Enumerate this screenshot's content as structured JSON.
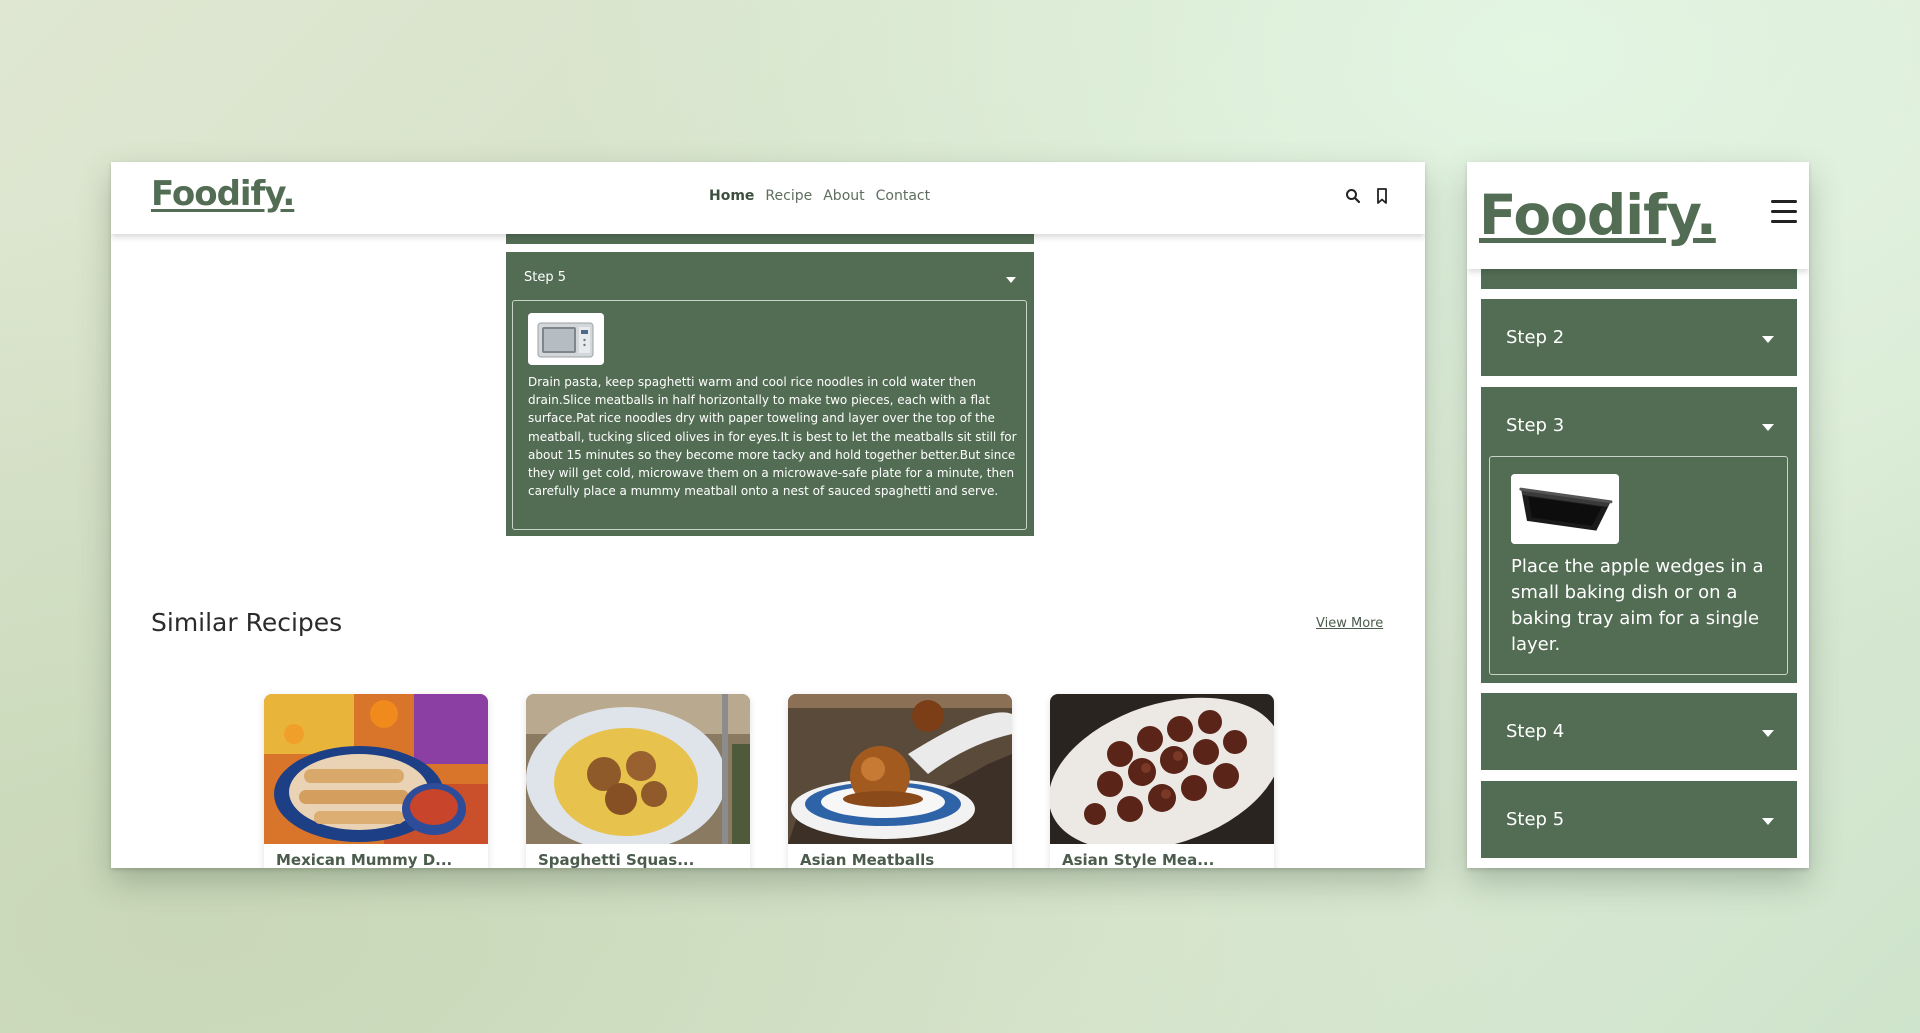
{
  "brand": {
    "logo": "Foodify."
  },
  "nav": {
    "items": [
      {
        "label": "Home"
      },
      {
        "label": "Recipe"
      },
      {
        "label": "About"
      },
      {
        "label": "Contact"
      }
    ]
  },
  "icons": {
    "search": "search-icon",
    "bookmark": "bookmark-icon",
    "menu": "hamburger-menu-icon",
    "dropdown": "caret-down-icon"
  },
  "desktop_step": {
    "label": "Step 5",
    "text": "Drain pasta, keep spaghetti warm and cool rice noodles in cold water then drain.Slice meatballs in half horizontally to make two pieces, each with a flat surface.Pat rice noodles dry with paper toweling and layer over the top of the meatball, tucking sliced olives in for eyes.It is best to let the meatballs sit still for about 15 minutes so they become more tacky and hold together better.But since they will get cold, microwave them on a microwave-safe plate for a minute, then carefully place a mummy meatball onto a nest of sauced spaghetti and serve."
  },
  "similar": {
    "title": "Similar Recipes",
    "view_more": "View More",
    "cards": [
      {
        "title": "Mexican Mummy D..."
      },
      {
        "title": "Spaghetti Squas..."
      },
      {
        "title": "Asian Meatballs"
      },
      {
        "title": "Asian Style Mea..."
      }
    ]
  },
  "mobile_steps": {
    "step2": "Step 2",
    "step3": "Step 3",
    "step3_text": "Place the apple wedges in a small baking dish or on a baking tray aim for a single layer.",
    "step4": "Step 4",
    "step5": "Step 5"
  },
  "colors": {
    "primary": "#536d54",
    "text_dark": "#2b2b2b"
  }
}
